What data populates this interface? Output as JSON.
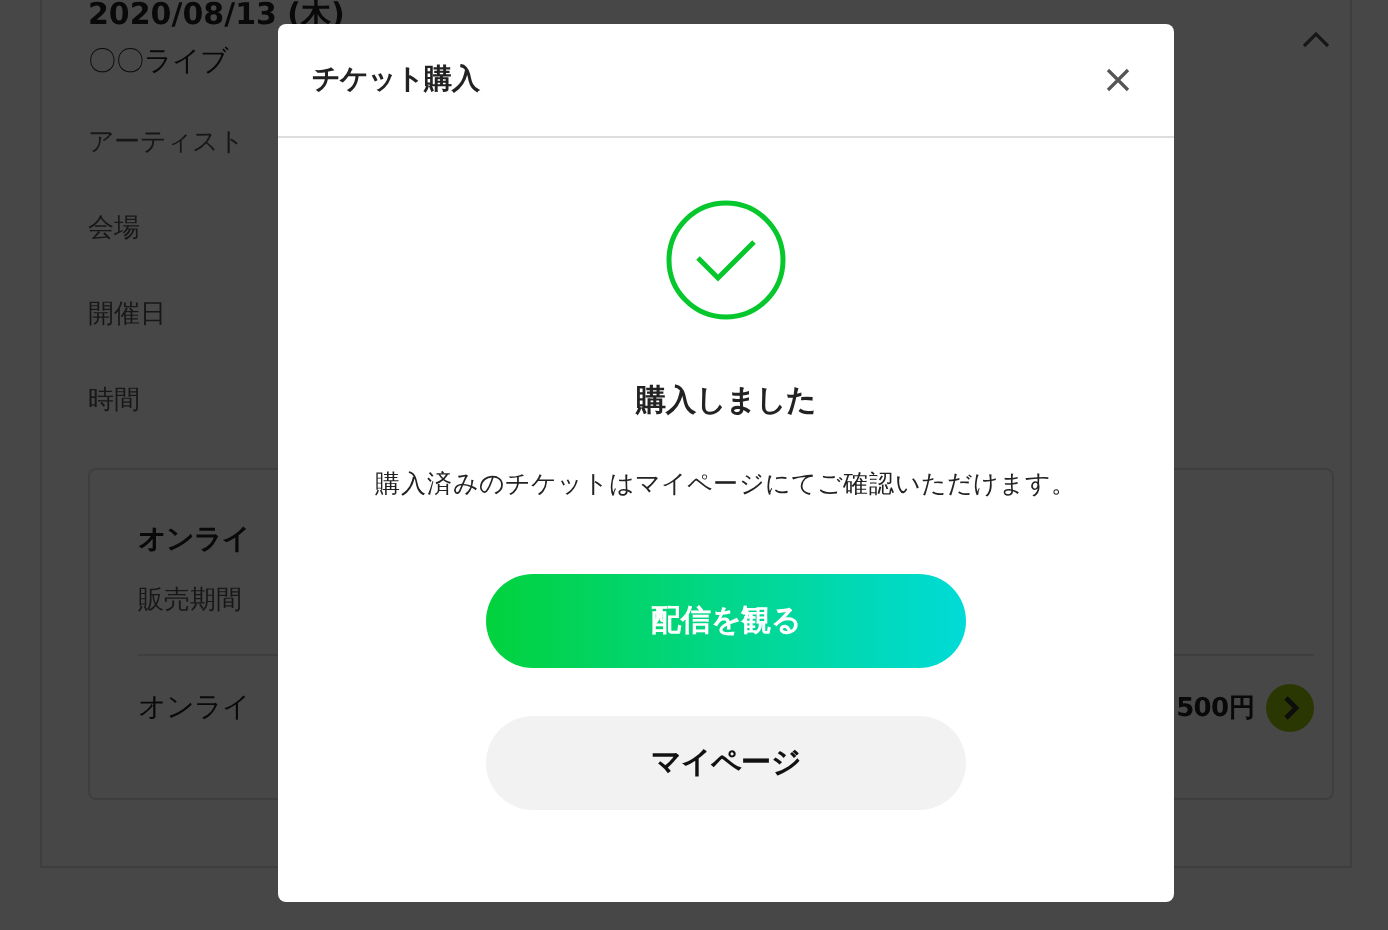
{
  "event": {
    "date": "2020/08/13 (木)",
    "venue_name": "〇〇ライブ",
    "fields": [
      "アーティスト",
      "会場",
      "開催日",
      "時間"
    ],
    "expanded": true
  },
  "ticket_card": {
    "title": "オンライ",
    "sales_period_label": "販売期間",
    "ticket_name": "オンライ",
    "price": "500円"
  },
  "dialog": {
    "title": "チケット購入",
    "heading": "購入しました",
    "message": "購入済みのチケットはマイページにてご確認いただけます。",
    "buttons": [
      {
        "label": "配信を観る",
        "kind": "primary"
      },
      {
        "label": "マイページ",
        "kind": "secondary"
      }
    ]
  }
}
